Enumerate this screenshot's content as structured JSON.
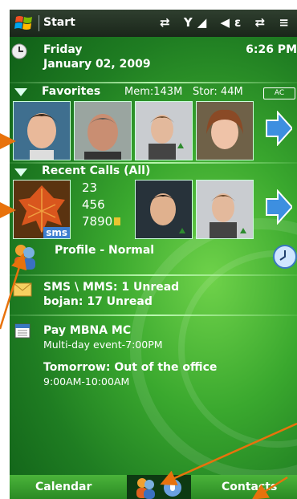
{
  "titlebar": {
    "title": "Start",
    "sys_icons": "⇄ Y◢ ◀ε ⇄ ≡"
  },
  "datetime": {
    "day": "Friday",
    "date": "January 02, 2009",
    "time": "6:26 PM"
  },
  "favorites": {
    "header": "Favorites",
    "mem": "Mem:143M",
    "stor": "Stor: 44M",
    "badge": "AC"
  },
  "recent": {
    "header": "Recent Calls (All)",
    "numbers": [
      "23",
      "456",
      "7890"
    ],
    "sms_label": "sms"
  },
  "profile": {
    "label": "Profile - Normal"
  },
  "messages": {
    "line1": "SMS \\ MMS: 1 Unread",
    "line2": "bojan: 17 Unread"
  },
  "calendar": {
    "event1_title": "Pay MBNA MC",
    "event1_detail": "Multi-day event-7:00PM",
    "event2_title": "Tomorrow: Out of the office",
    "event2_detail": "9:00AM-10:00AM"
  },
  "softkeys": {
    "left": "Calendar",
    "right": "Contacts"
  },
  "colors": {
    "accent": "#2f9e2a",
    "annotation": "#e8720c"
  }
}
